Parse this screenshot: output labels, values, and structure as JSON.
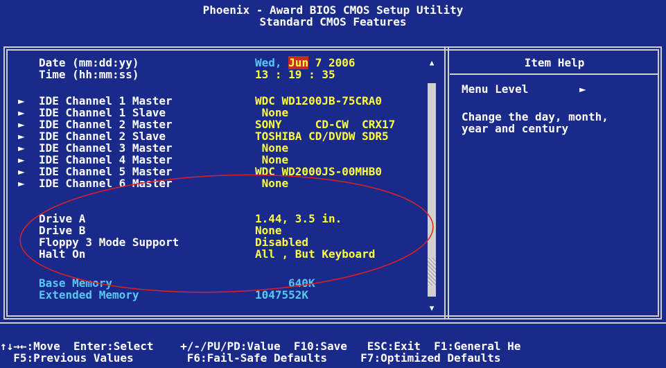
{
  "header": {
    "title": "Phoenix - Award BIOS CMOS Setup Utility",
    "subtitle": "Standard CMOS Features"
  },
  "settings": {
    "date_label": "Date (mm:dd:yy)",
    "date_day": "Wed,",
    "date_month": "Jun",
    "date_rest": " 7 2006",
    "time_label": "Time (hh:mm:ss)",
    "time_value": "13 : 19 : 35",
    "ide": [
      {
        "label": "IDE Channel 1 Master",
        "value": "WDC WD1200JB-75CRA0"
      },
      {
        "label": "IDE Channel 1 Slave",
        "value": " None"
      },
      {
        "label": "IDE Channel 2 Master",
        "value": "SONY     CD-CW  CRX17"
      },
      {
        "label": "IDE Channel 2 Slave",
        "value": "TOSHIBA CD/DVDW SDR5"
      },
      {
        "label": "IDE Channel 3 Master",
        "value": " None"
      },
      {
        "label": "IDE Channel 4 Master",
        "value": " None"
      },
      {
        "label": "IDE Channel 5 Master",
        "value": "WDC WD2000JS-00MHB0"
      },
      {
        "label": "IDE Channel 6 Master",
        "value": " None"
      }
    ],
    "drive_a_label": "Drive A",
    "drive_a_value": "1.44, 3.5 in.",
    "drive_b_label": "Drive B",
    "drive_b_value": "None",
    "floppy_label": "Floppy 3 Mode Support",
    "floppy_value": "Disabled",
    "halt_label": "Halt On",
    "halt_value": "All , But Keyboard",
    "base_mem_label": "Base Memory",
    "base_mem_value": "640K",
    "ext_mem_label": "Extended Memory",
    "ext_mem_value": "1047552K"
  },
  "help": {
    "title": "Item Help",
    "menu_level": "Menu Level",
    "menu_level_arrow": "►",
    "text_line1": "Change the day, month,",
    "text_line2": "year and century"
  },
  "arrow_glyph": "►",
  "scroll_up": "▲",
  "scroll_down": "▼",
  "footer": {
    "line1": "↑↓→←:Move  Enter:Select    +/-/PU/PD:Value  F10:Save   ESC:Exit  F1:General He",
    "line2": "  F5:Previous Values        F6:Fail-Safe Defaults     F7:Optimized Defaults"
  },
  "colors": {
    "background": "#1a2a8a",
    "value": "#ffff40",
    "label": "#ffffff",
    "dim": "#58c8f0",
    "highlight": "#c03020",
    "annotation": "#e02020"
  }
}
